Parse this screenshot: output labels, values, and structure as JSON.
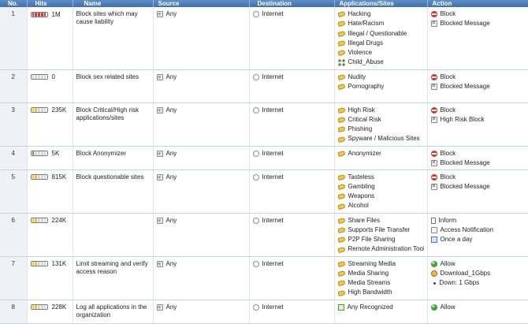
{
  "columns": [
    "No.",
    "Hits",
    "Name",
    "Source",
    "Destination",
    "Applications/Sites",
    "Action"
  ],
  "colors": {
    "header": "#4a7dbd",
    "red": "#d9352b",
    "yellow": "#efc62d",
    "green": "#3eae3a",
    "empty": "#d6d6d6"
  },
  "rows": [
    {
      "no": "1",
      "hits": "1M",
      "level": 5,
      "color": "red",
      "name": "Block sites which may cause liability",
      "source": "Any",
      "destination": "Internet",
      "apps": [
        {
          "icon": "tag",
          "text": "Hacking"
        },
        {
          "icon": "tag",
          "text": "Hate/Racism"
        },
        {
          "icon": "tag",
          "text": "Illegal / Questionable"
        },
        {
          "icon": "tag",
          "text": "Illegal Drugs"
        },
        {
          "icon": "tag",
          "text": "Violence"
        },
        {
          "icon": "group",
          "text": "Child_Abuse"
        }
      ],
      "actions": [
        {
          "icon": "block",
          "text": "Block"
        },
        {
          "icon": "msg",
          "text": "Blocked Message"
        }
      ]
    },
    {
      "no": "2",
      "hits": "0",
      "level": 0,
      "color": "empty",
      "name": "Block sex related sites",
      "source": "Any",
      "destination": "Internet",
      "apps": [
        {
          "icon": "tag",
          "text": "Nudity"
        },
        {
          "icon": "tag",
          "text": "Pornography"
        }
      ],
      "actions": [
        {
          "icon": "block",
          "text": "Block"
        },
        {
          "icon": "msg",
          "text": "Blocked Message"
        }
      ]
    },
    {
      "no": "3",
      "hits": "235K",
      "level": 2,
      "color": "yellow",
      "name": "Block Critical/High risk applications/sites",
      "source": "Any",
      "destination": "Internet",
      "apps": [
        {
          "icon": "tag",
          "text": "High Risk"
        },
        {
          "icon": "tag",
          "text": "Critical Risk"
        },
        {
          "icon": "tag",
          "text": "Phishing"
        },
        {
          "icon": "tag",
          "text": "Spyware / Malicious Sites"
        }
      ],
      "actions": [
        {
          "icon": "block",
          "text": "Block"
        },
        {
          "icon": "msg",
          "text": "High Risk Block"
        }
      ]
    },
    {
      "no": "4",
      "hits": "5K",
      "level": 1,
      "color": "green",
      "name": "Block Anonymizer",
      "source": "Any",
      "destination": "Internet",
      "apps": [
        {
          "icon": "tag",
          "text": "Anonymizer"
        }
      ],
      "actions": [
        {
          "icon": "block",
          "text": "Block"
        },
        {
          "icon": "msg",
          "text": "Blocked Message"
        }
      ]
    },
    {
      "no": "5",
      "hits": "815K",
      "level": 2,
      "color": "yellow",
      "name": "Block questionable sites",
      "source": "Any",
      "destination": "Internet",
      "apps": [
        {
          "icon": "tag",
          "text": "Tasteless"
        },
        {
          "icon": "tag",
          "text": "Gambling"
        },
        {
          "icon": "tag",
          "text": "Weapons"
        },
        {
          "icon": "tag",
          "text": "Alcohol"
        }
      ],
      "actions": [
        {
          "icon": "block",
          "text": "Block"
        },
        {
          "icon": "msg",
          "text": "Blocked Message"
        }
      ]
    },
    {
      "no": "6",
      "hits": "224K",
      "level": 2,
      "color": "yellow",
      "name": "",
      "source": "Any",
      "destination": "Internet",
      "apps": [
        {
          "icon": "tag",
          "text": "Share Files"
        },
        {
          "icon": "tag",
          "text": "Supports File Transfer"
        },
        {
          "icon": "tag",
          "text": "P2P File Sharing"
        },
        {
          "icon": "tag",
          "text": "Remote Administration Tool"
        }
      ],
      "actions": [
        {
          "icon": "inform",
          "text": "Inform"
        },
        {
          "icon": "notif",
          "text": "Access Notification"
        },
        {
          "icon": "cal",
          "text": "Once a day"
        }
      ]
    },
    {
      "no": "7",
      "hits": "131K",
      "level": 2,
      "color": "yellow",
      "name": "Limit streaming and verify access reason",
      "source": "Any",
      "destination": "Internet",
      "apps": [
        {
          "icon": "tag",
          "text": "Streaming Media"
        },
        {
          "icon": "tag",
          "text": "Media Sharing"
        },
        {
          "icon": "tag",
          "text": "Media Streams"
        },
        {
          "icon": "tag",
          "text": "High Bandwidth"
        }
      ],
      "actions": [
        {
          "icon": "allow",
          "text": "Allow"
        },
        {
          "icon": "gauge",
          "text": "Download_1Gbps"
        },
        {
          "icon": "bullet",
          "text": "Down: 1 Gbps"
        }
      ]
    },
    {
      "no": "8",
      "hits": "228K",
      "level": 2,
      "color": "yellow",
      "name": "Log all applications in the organization",
      "source": "Any",
      "destination": "Internet",
      "apps": [
        {
          "icon": "anyrec",
          "text": "Any Recognized"
        }
      ],
      "actions": [
        {
          "icon": "allow",
          "text": "Allow"
        }
      ]
    }
  ]
}
